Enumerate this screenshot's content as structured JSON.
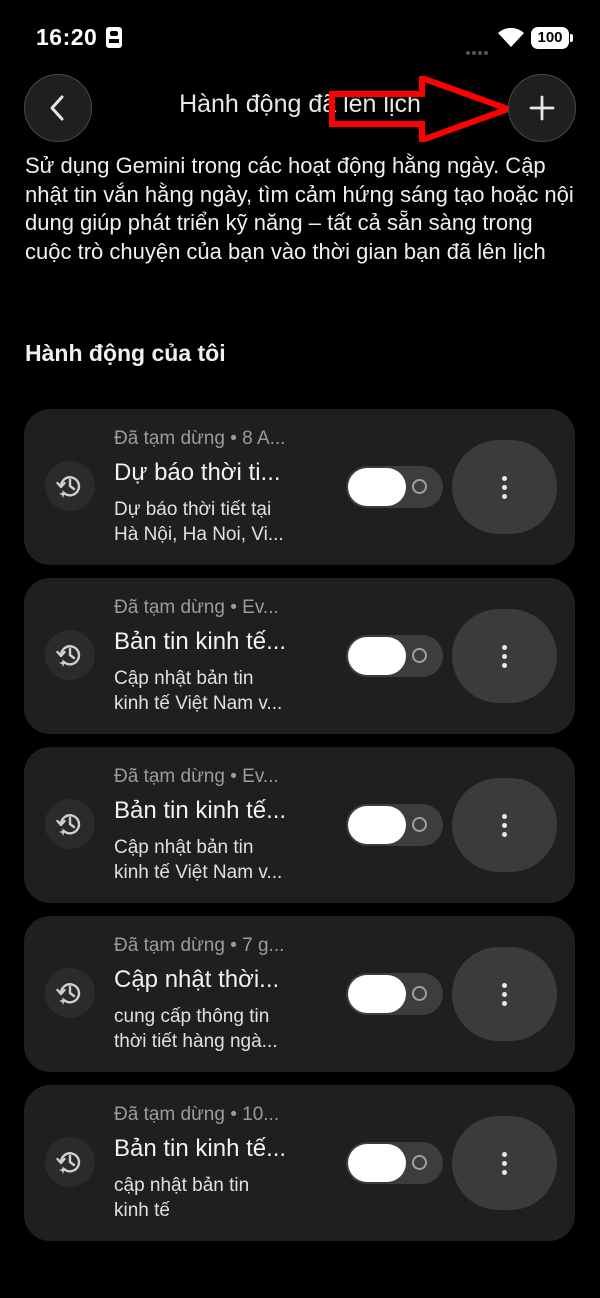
{
  "status_bar": {
    "time": "16:20",
    "battery": "100"
  },
  "header": {
    "title": "Hành động đã lên lịch"
  },
  "description": "Sử dụng Gemini trong các hoạt động hằng ngày. Cập nhật tin vắn hằng ngày, tìm cảm hứng sáng tạo hoặc nội dung giúp phát triển kỹ năng – tất cả sẵn sàng trong cuộc trò chuyện của bạn vào thời gian bạn đã lên lịch",
  "section_title": "Hành động của tôi",
  "actions": [
    {
      "meta": "Đã tạm dừng • 8 A...",
      "title": "Dự báo thời ti...",
      "desc_line1": "Dự báo thời tiết tại",
      "desc_line2": "Hà Nội, Ha Noi, Vi..."
    },
    {
      "meta": "Đã tạm dừng • Ev...",
      "title": "Bản tin kinh tế...",
      "desc_line1": "Cập nhật bản tin",
      "desc_line2": "kinh tế Việt Nam v..."
    },
    {
      "meta": "Đã tạm dừng • Ev...",
      "title": "Bản tin kinh tế...",
      "desc_line1": "Cập nhật bản tin",
      "desc_line2": "kinh tế Việt Nam v..."
    },
    {
      "meta": "Đã tạm dừng • 7 g...",
      "title": "Cập nhật thời...",
      "desc_line1": "cung cấp thông tin",
      "desc_line2": "thời tiết hàng ngà..."
    },
    {
      "meta": "Đã tạm dừng • 10...",
      "title": "Bản tin kinh tế...",
      "desc_line1": "cập nhật bản tin",
      "desc_line2": "kinh tế"
    }
  ],
  "icons": {
    "back": "arrow-back-icon",
    "add": "plus-icon",
    "action": "scheduled-history-icon",
    "more": "more-vert-icon",
    "annotation": "red-arrow-annotation"
  },
  "colors": {
    "annotation": "#ff0000",
    "card": "#1e1f20",
    "background": "#000000"
  },
  "toggles_on": [
    false,
    false,
    false,
    false,
    false
  ]
}
